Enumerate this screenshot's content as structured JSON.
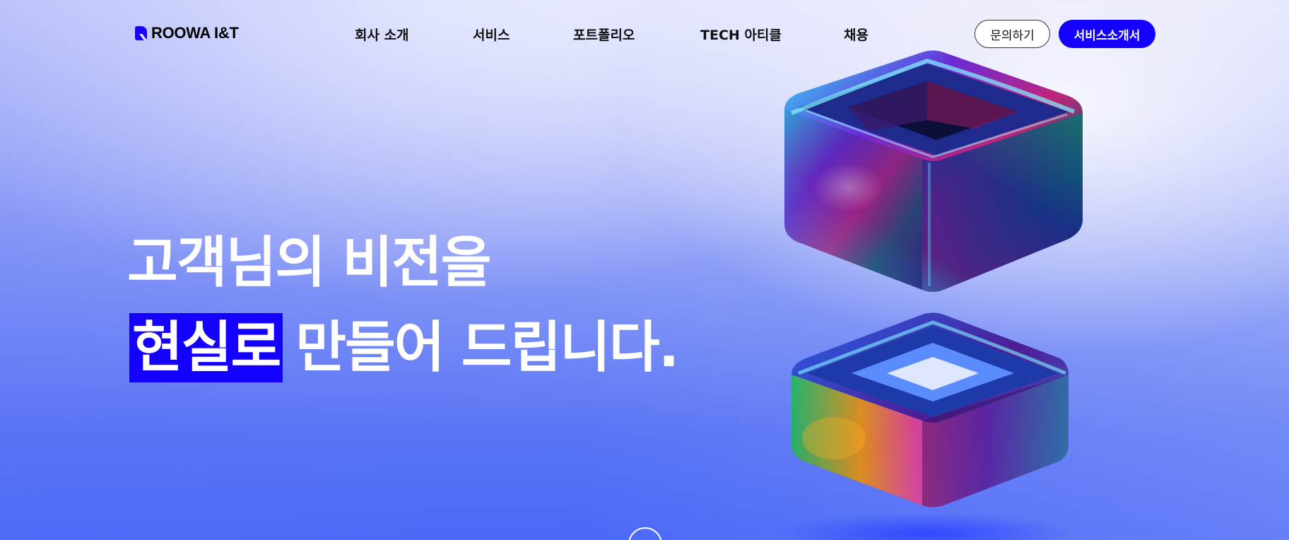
{
  "brand": {
    "logo_text": "ROOWA I&T"
  },
  "nav": {
    "items": [
      {
        "label": "회사 소개"
      },
      {
        "label": "서비스"
      },
      {
        "label": "포트폴리오"
      },
      {
        "label": "TECH 아티클"
      },
      {
        "label": "채용"
      }
    ]
  },
  "actions": {
    "contact_label": "문의하기",
    "brochure_label": "서비스소개서"
  },
  "hero": {
    "line1": "고객님의 비전을",
    "line2_highlight": "현실로",
    "line2_rest": "만들어 드립니다."
  },
  "colors": {
    "accent": "#1400ff",
    "nav_text": "#111111",
    "hero_text": "#ffffff"
  },
  "icons": {
    "logo": "roowa-r-logo-icon",
    "scroll": "scroll-down-icon"
  }
}
